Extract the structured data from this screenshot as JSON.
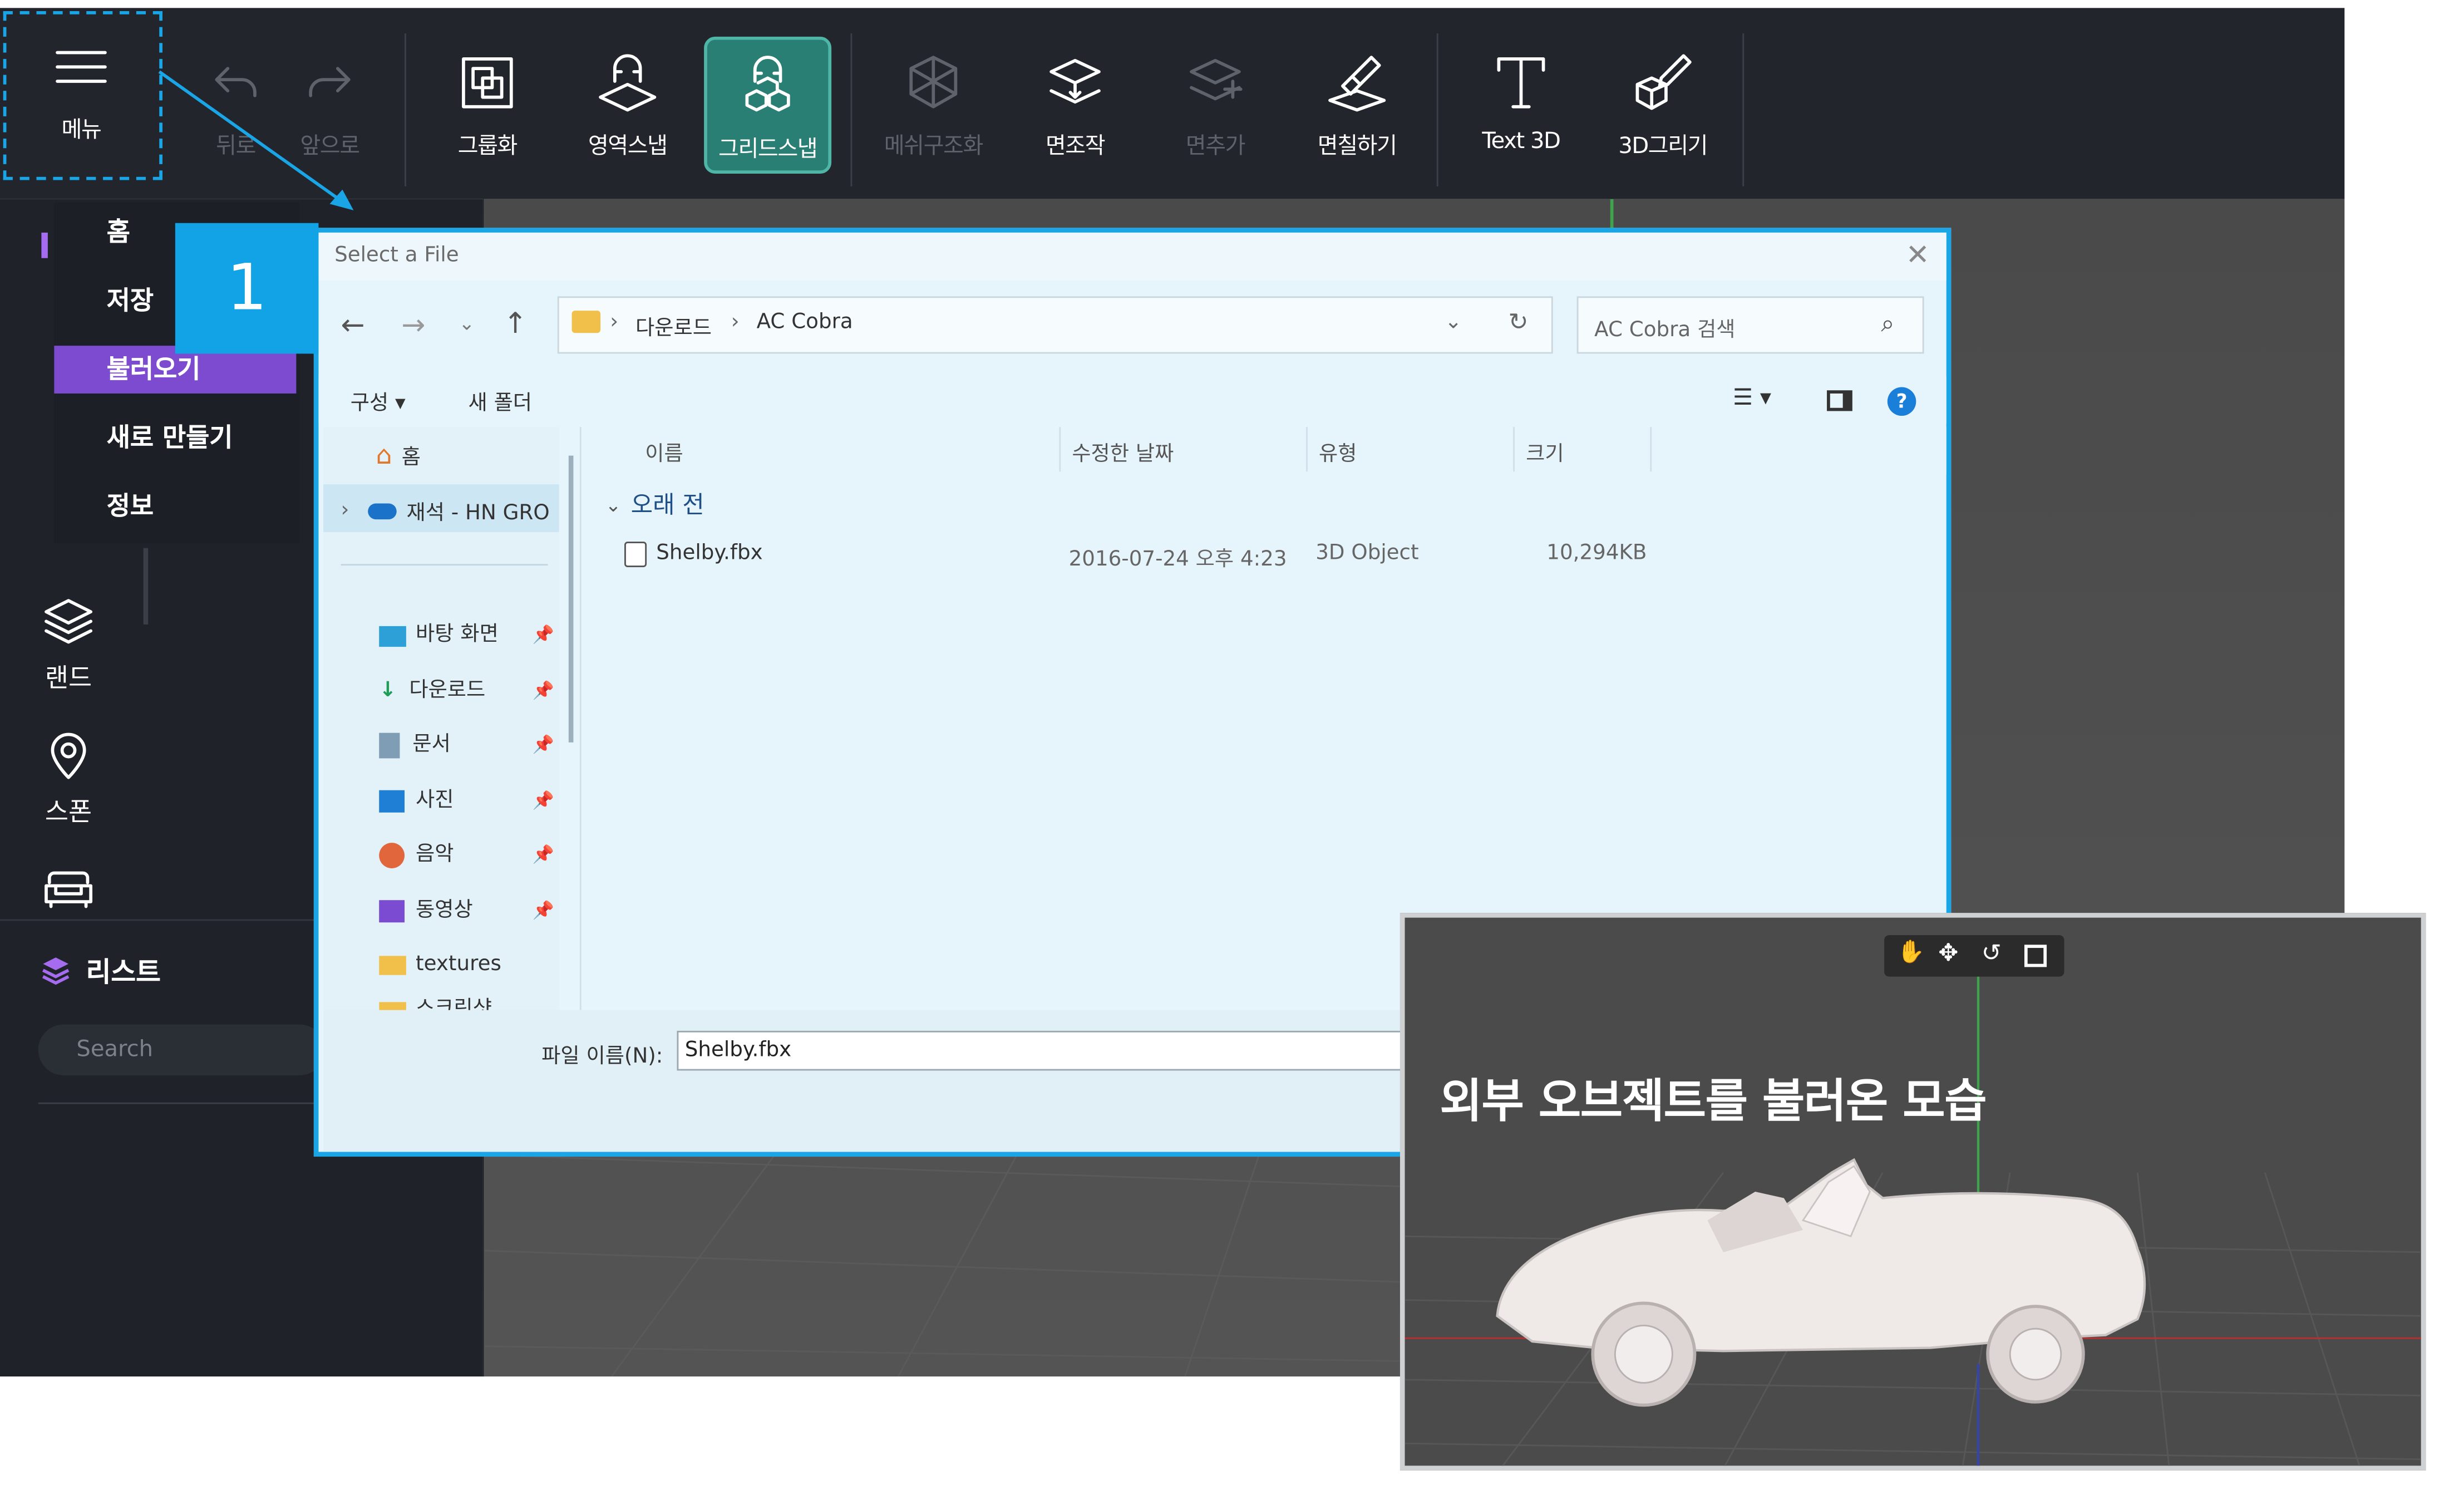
{
  "toolbar": {
    "menu_label": "메뉴",
    "undo_label": "뒤로",
    "redo_label": "앞으로",
    "group_label": "그룹화",
    "area_snap_label": "영역스냅",
    "grid_snap_label": "그리드스냅",
    "mesh_label": "메쉬구조화",
    "face_edit_label": "면조작",
    "face_add_label": "면추가",
    "face_paint_label": "면칠하기",
    "text3d_label": "Text 3D",
    "draw3d_label": "3D그리기"
  },
  "menu": {
    "items": [
      "홈",
      "저장",
      "불러오기",
      "새로 만들기",
      "정보"
    ],
    "selected": "불러오기"
  },
  "sidebar": {
    "land_label": "랜드",
    "spawn_label": "스폰",
    "list_title": "리스트",
    "search_placeholder": "Search"
  },
  "callout": {
    "number": "1"
  },
  "dialog": {
    "title": "Select a File",
    "path": [
      "다운로드",
      "AC Cobra"
    ],
    "search_placeholder": "AC Cobra 검색",
    "organize_label": "구성",
    "new_folder_label": "새 폴더",
    "nav": {
      "home": "홈",
      "onedrive": "재석 - HN GRO",
      "quick": [
        {
          "label": "바탕 화면",
          "icon": "desktop-icon"
        },
        {
          "label": "다운로드",
          "icon": "download-icon"
        },
        {
          "label": "문서",
          "icon": "document-icon"
        },
        {
          "label": "사진",
          "icon": "picture-icon"
        },
        {
          "label": "음악",
          "icon": "music-icon"
        },
        {
          "label": "동영상",
          "icon": "video-icon"
        },
        {
          "label": "textures",
          "icon": "folder-icon"
        },
        {
          "label": "스크린샷",
          "icon": "folder-icon"
        }
      ]
    },
    "columns": {
      "name": "이름",
      "date": "수정한 날짜",
      "type": "유형",
      "size": "크기"
    },
    "group_header": "오래 전",
    "files": [
      {
        "name": "Shelby.fbx",
        "date": "2016-07-24 오후 4:23",
        "type": "3D Object",
        "size": "10,294KB"
      }
    ],
    "filename_label": "파일 이름(N):",
    "filename_value": "Shelby.fbx"
  },
  "inset": {
    "title": "외부 오브젝트를 불러온 모습"
  },
  "colors": {
    "toolbar_bg": "#22252c",
    "active_teal": "#2a7f74",
    "menu_selected": "#7c4bd0",
    "highlight_blue": "#1aa6e6"
  }
}
